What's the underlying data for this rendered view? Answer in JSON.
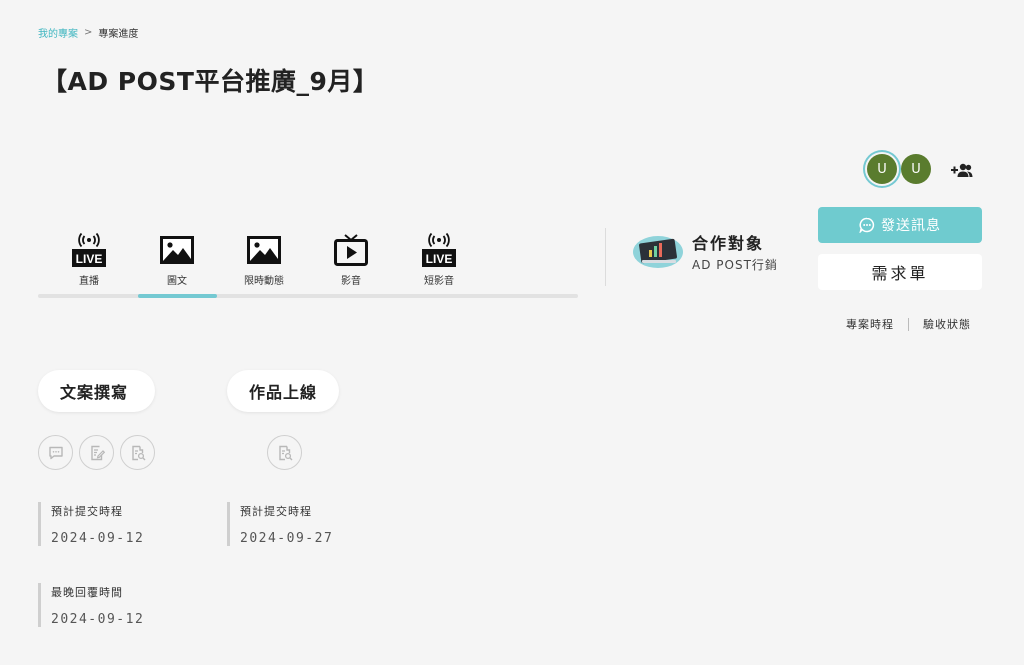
{
  "breadcrumb": {
    "parent": "我的專案",
    "separator": ">",
    "current": "專案進度"
  },
  "project": {
    "title": "【AD POST平台推廣_9月】"
  },
  "members": {
    "avatars": [
      "U",
      "U"
    ]
  },
  "tabs": [
    {
      "label": "直播",
      "icon": "live-icon",
      "badge": "LIVE"
    },
    {
      "label": "圖文",
      "icon": "image-icon",
      "active": true
    },
    {
      "label": "限時動態",
      "icon": "image-icon"
    },
    {
      "label": "影音",
      "icon": "tv-play-icon"
    },
    {
      "label": "短影音",
      "icon": "live-icon",
      "badge": "LIVE"
    }
  ],
  "partner": {
    "title": "合作對象",
    "name": "AD POST行銷"
  },
  "buttons": {
    "message": "發送訊息",
    "requirement": "需求單"
  },
  "side_links": {
    "timeline": "專案時程",
    "acceptance": "驗收狀態"
  },
  "stages": [
    {
      "label": "文案撰寫",
      "actions": [
        "chat-icon",
        "edit-doc-icon",
        "search-doc-icon"
      ],
      "info": [
        {
          "label": "預計提交時程",
          "value": "2024-09-12"
        },
        {
          "label": "最晚回覆時間",
          "value": "2024-09-12"
        }
      ]
    },
    {
      "label": "作品上線",
      "actions": [
        "search-doc-icon"
      ],
      "info": [
        {
          "label": "預計提交時程",
          "value": "2024-09-27"
        }
      ]
    }
  ],
  "colors": {
    "accent": "#74c9d2",
    "button": "#6fcbcf",
    "avatar": "#5a7c2e",
    "link": "#3fb6c0"
  }
}
